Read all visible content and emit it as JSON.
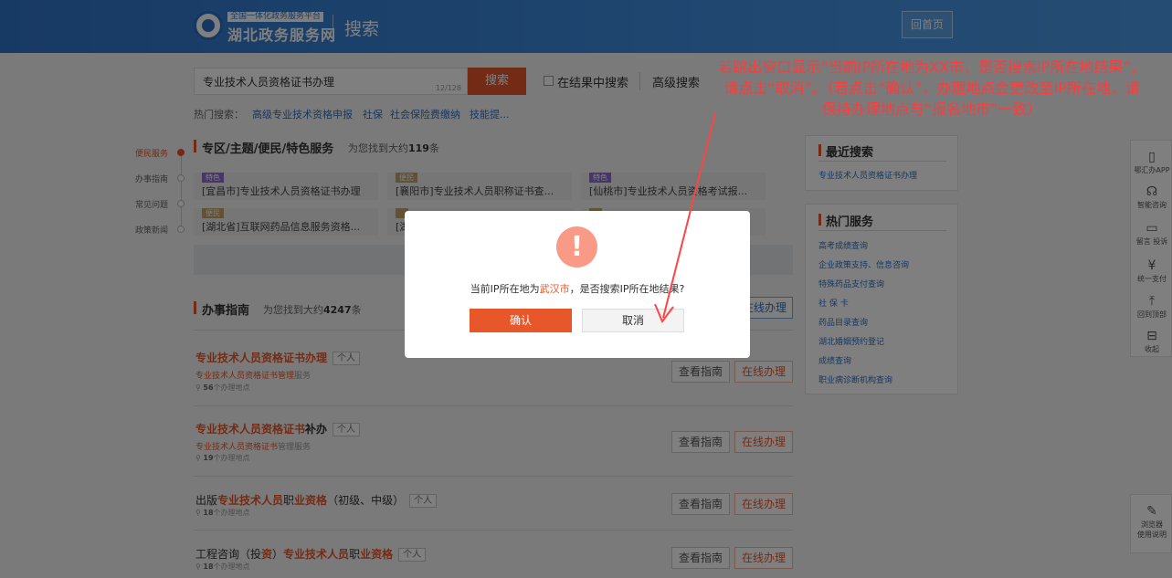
{
  "header": {
    "logo_tag": "全国一体化政务服务平台",
    "logo_name": "湖北政务服务网",
    "title": "搜索",
    "home": "回首页"
  },
  "search": {
    "value": "专业技术人员资格证书办理",
    "count": "12/128",
    "button": "搜索",
    "in_results": "在结果中搜索",
    "advanced": "高级搜索"
  },
  "hot": {
    "label": "热门搜索：",
    "links": [
      "高级专业技术资格申报",
      "社保",
      "社会保险费缴纳",
      "技能提..."
    ]
  },
  "timeline": [
    "便民服务",
    "办事指南",
    "常见问题",
    "政策新闻"
  ],
  "section1": {
    "title": "专区/主题/便民/特色服务",
    "sub_prefix": "为您找到大约",
    "count": "119",
    "sub_suffix": "条",
    "cards": [
      {
        "tag": "特色",
        "text": "[宜昌市]专业技术人员资格证书办理"
      },
      {
        "tag": "便民",
        "text": "[襄阳市]专业技术人员职称证书查..."
      },
      {
        "tag": "特色",
        "text": "[仙桃市]专业技术人员资格考试报..."
      },
      {
        "tag": "便民",
        "text": "[湖北省]互联网药品信息服务资格..."
      },
      {
        "tag": "",
        "text": "[湖"
      }
    ]
  },
  "section2": {
    "title": "办事指南",
    "sub_prefix": "为您找到大约",
    "count": "4247",
    "sub_suffix": "条",
    "online_btn": "在线办理"
  },
  "items": [
    {
      "title_hl": "专业技术人员资格证书办理",
      "title_rest": "",
      "title_pre": "",
      "tag": "个人",
      "sub_hl": "专业技术人员资格证书管理",
      "sub_rest": "服务",
      "loc_count": "56",
      "loc_text": "个办理地点"
    },
    {
      "title_hl": "专业技术人员资格证书",
      "title_rest": "补办",
      "title_pre": "",
      "tag": "个人",
      "sub_hl": "专业技术人员资格证书",
      "sub_rest": "管理服务",
      "loc_count": "19",
      "loc_text": "个办理地点"
    },
    {
      "title_pre": "出版",
      "title_hl": "专业技术人员",
      "title_mid": "职",
      "title_hl2": "业资格",
      "title_rest": "（初级、中级）",
      "tag": "个人",
      "loc_count": "18",
      "loc_text": "个办理地点"
    },
    {
      "title_pre": "工程咨询（投",
      "title_hl": "资",
      "title_mid": "）",
      "title_hl2": "专业技术人员",
      "title_mid2": "职",
      "title_hl3": "业资格",
      "tag": "个人",
      "loc_count": "18",
      "loc_text": "个办理地点"
    }
  ],
  "buttons": {
    "guide": "查看指南",
    "online": "在线办理"
  },
  "panel_recent": {
    "title": "最近搜索",
    "links": [
      "专业技术人员资格证书办理"
    ]
  },
  "panel_hot": {
    "title": "热门服务",
    "links": [
      "高考成绩查询",
      "企业政策支持、信息咨询",
      "特殊药品支付查询",
      "社 保 卡",
      "药品目录查询",
      "湖北婚姻预约登记",
      "成绩查询",
      "职业病诊断机构查询"
    ]
  },
  "sidebar": [
    {
      "icon": "phone-icon",
      "glyph": "▯",
      "label": "鄂汇办APP"
    },
    {
      "icon": "headset-icon",
      "glyph": "☊",
      "label": "智能咨询"
    },
    {
      "icon": "message-icon",
      "glyph": "▭",
      "label": "留言 投诉"
    },
    {
      "icon": "yen-icon",
      "glyph": "¥",
      "label": "统一支付"
    },
    {
      "icon": "to-top-icon",
      "glyph": "⤒",
      "label": "回到顶部"
    },
    {
      "icon": "collapse-icon",
      "glyph": "⊟",
      "label": "收起"
    }
  ],
  "sidebar2": {
    "icon": "browser-icon",
    "glyph": "✎",
    "label1": "浏览器",
    "label2": "使用说明"
  },
  "modal": {
    "msg_pre": "当前IP所在地为",
    "city": "武汉市",
    "msg_post": "，是否搜索IP所在地结果?",
    "confirm": "确认",
    "cancel": "取消"
  },
  "annotation": "若跳出窗口显示“当前IP所在地为XX市，是否搜索IP所在地结果”，请点击“取消”。（若点击“确认”，办理地点会更改至IP所在地，请保持办理地点与“报名地市”一致）",
  "colors": {
    "accent": "#e8572a",
    "link": "#2f6fc6",
    "header": "#3a86d8",
    "annotation": "#ff3b3b"
  }
}
